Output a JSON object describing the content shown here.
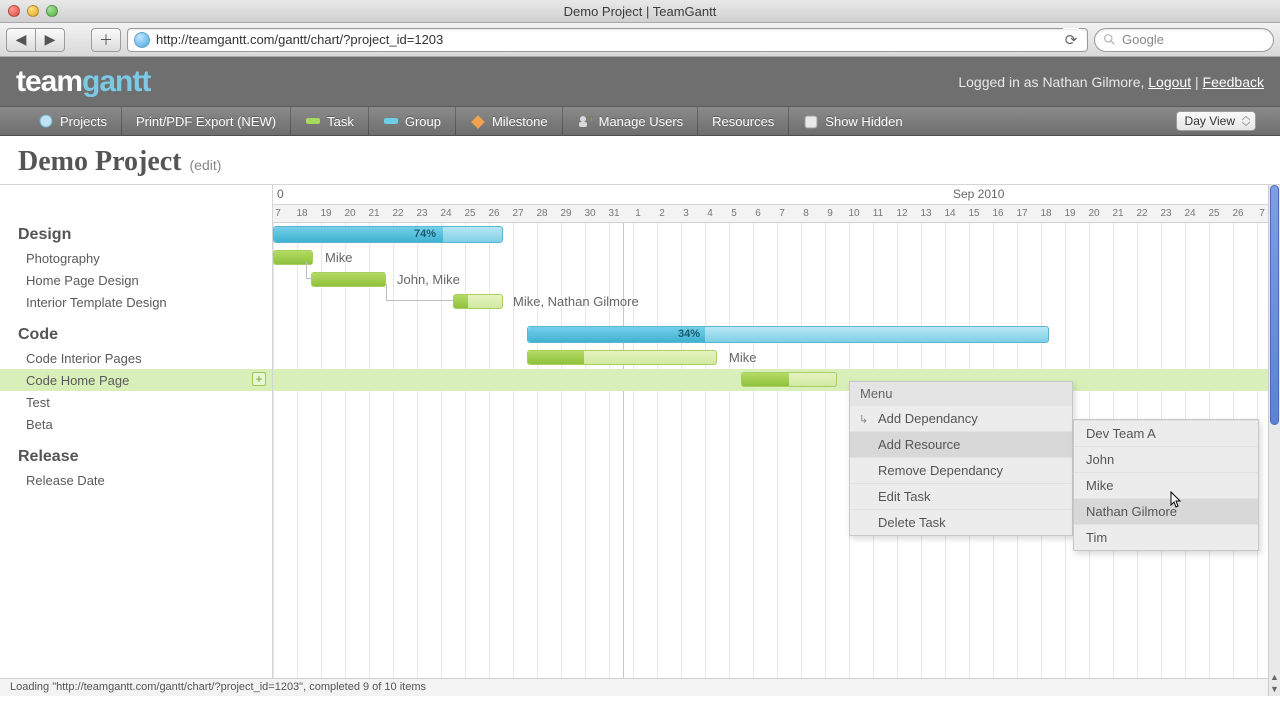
{
  "window": {
    "title": "Demo Project | TeamGantt"
  },
  "browser": {
    "url": "http://teamgantt.com/gantt/chart/?project_id=1203",
    "search_placeholder": "Google"
  },
  "logo": {
    "part1": "team",
    "part2": "gantt"
  },
  "user": {
    "prefix": "Logged in as ",
    "name": "Nathan Gilmore",
    "comma": ", ",
    "logout": "Logout",
    "sep": " | ",
    "feedback": "Feedback"
  },
  "toolbar": {
    "projects": "Projects",
    "print": "Print/PDF Export (NEW)",
    "task": "Task",
    "group": "Group",
    "milestone": "Milestone",
    "manage_users": "Manage Users",
    "resources": "Resources",
    "show_hidden": "Show Hidden",
    "view_select": "Day View"
  },
  "project": {
    "name": "Demo Project",
    "edit": "(edit)"
  },
  "timeline": {
    "month_left_fragment": "0",
    "month_right": "Sep 2010",
    "days": [
      "7",
      "18",
      "19",
      "20",
      "21",
      "22",
      "23",
      "24",
      "25",
      "26",
      "27",
      "28",
      "29",
      "30",
      "31",
      "1",
      "2",
      "3",
      "4",
      "5",
      "6",
      "7",
      "8",
      "9",
      "10",
      "11",
      "12",
      "13",
      "14",
      "15",
      "16",
      "17",
      "18",
      "19",
      "20",
      "21",
      "22",
      "23",
      "24",
      "25",
      "26",
      "7"
    ]
  },
  "groups": {
    "design": {
      "label": "Design",
      "pct": "74%",
      "tasks": {
        "photography": {
          "label": "Photography",
          "assignees": "Mike"
        },
        "homepage": {
          "label": "Home Page Design",
          "assignees": "John, Mike"
        },
        "interior": {
          "label": "Interior Template Design",
          "assignees": "Mike, Nathan Gilmore"
        }
      }
    },
    "code": {
      "label": "Code",
      "pct": "34%",
      "tasks": {
        "interior": {
          "label": "Code Interior Pages",
          "assignees": "Mike"
        },
        "homepage": {
          "label": "Code Home Page"
        },
        "test": {
          "label": "Test"
        },
        "beta": {
          "label": "Beta"
        }
      }
    },
    "release": {
      "label": "Release",
      "tasks": {
        "date": {
          "label": "Release Date"
        }
      }
    }
  },
  "context_menu": {
    "title": "Menu",
    "items": {
      "add_dep": "Add Dependancy",
      "add_res": "Add Resource",
      "rem_dep": "Remove Dependancy",
      "edit": "Edit Task",
      "delete": "Delete Task"
    }
  },
  "resource_menu": {
    "items": [
      "Dev Team A",
      "John",
      "Mike",
      "Nathan Gilmore",
      "Tim"
    ]
  },
  "status": "Loading \"http://teamgantt.com/gantt/chart/?project_id=1203\", completed 9 of 10 items"
}
